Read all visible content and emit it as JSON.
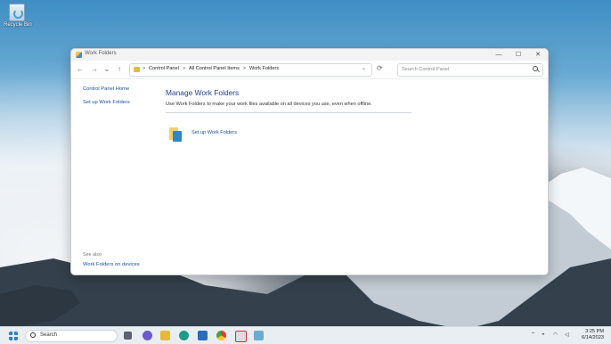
{
  "desktop": {
    "icons": [
      {
        "label": "Recycle Bin"
      }
    ]
  },
  "window": {
    "title": "Work Folders",
    "controls": {
      "minimize": "—",
      "maximize": "☐",
      "close": "✕"
    },
    "nav": {
      "back": "←",
      "forward": "→",
      "recent": "⌄",
      "up": "↑",
      "refresh": "⟳",
      "breadcrumb": [
        "Control Panel",
        "All Control Panel Items",
        "Work Folders"
      ],
      "separator": ">"
    },
    "search": {
      "placeholder": "Search Control Panel"
    },
    "sidebar": {
      "links": [
        "Control Panel Home",
        "Set up Work Folders"
      ],
      "see_also_heading": "See also",
      "see_also_link": "Work Folders on devices"
    },
    "main": {
      "heading": "Manage Work Folders",
      "description": "Use Work Folders to make your work files available on all devices you use, even when offline.",
      "task_label": "Set up Work Folders"
    }
  },
  "taskbar": {
    "search_label": "Search",
    "clock": {
      "time": "3:25 PM",
      "date": "6/14/2023"
    },
    "accent": "#2a7fd8"
  }
}
